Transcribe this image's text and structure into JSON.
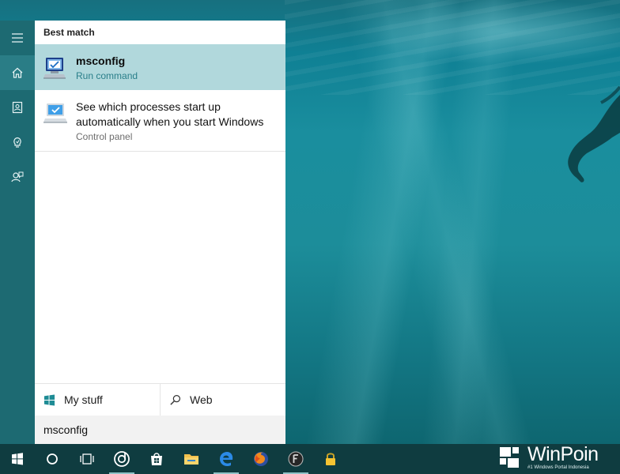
{
  "search_panel": {
    "section_header": "Best match",
    "results": [
      {
        "title": "msconfig",
        "subtitle": "Run command",
        "icon": "msconfig-computer-icon"
      },
      {
        "title": "See which processes start up automatically when you start Windows",
        "subtitle": "Control panel",
        "icon": "monitor-icon"
      }
    ],
    "scope_buttons": [
      {
        "label": "My stuff",
        "icon": "windows-logo-icon"
      },
      {
        "label": "Web",
        "icon": "search-icon"
      }
    ],
    "query": "msconfig"
  },
  "rail": {
    "items": [
      {
        "icon": "hamburger-menu-icon"
      },
      {
        "icon": "home-icon"
      },
      {
        "icon": "notebook-icon"
      },
      {
        "icon": "lightbulb-icon"
      },
      {
        "icon": "feedback-icon"
      }
    ]
  },
  "taskbar": {
    "items": [
      {
        "icon": "start-windows-icon"
      },
      {
        "icon": "cortana-circle-icon"
      },
      {
        "icon": "task-view-icon"
      },
      {
        "icon": "groove-music-icon"
      },
      {
        "icon": "store-icon"
      },
      {
        "icon": "file-explorer-icon"
      },
      {
        "icon": "edge-browser-icon"
      },
      {
        "icon": "firefox-icon"
      },
      {
        "icon": "app-f-icon"
      },
      {
        "icon": "lock-icon"
      }
    ]
  },
  "watermark": {
    "title": "WinPoin",
    "tagline": "#1 Windows Portal Indonesia"
  },
  "colors": {
    "rail_bg": "#1d6a72",
    "selected_result": "#b1d8dc",
    "accent_text": "#2a7f8a",
    "taskbar_bg": "#0f3c40"
  }
}
